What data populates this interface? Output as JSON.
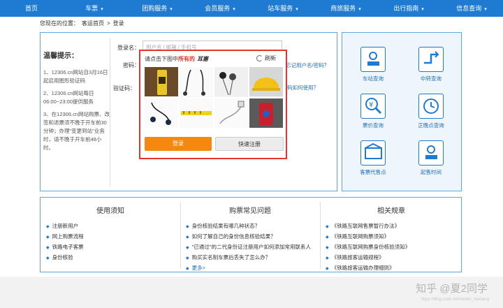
{
  "nav": [
    {
      "label": "首页",
      "caret": false
    },
    {
      "label": "车票",
      "caret": true
    },
    {
      "label": "团购服务",
      "caret": true
    },
    {
      "label": "会员服务",
      "caret": true
    },
    {
      "label": "站车服务",
      "caret": true
    },
    {
      "label": "商旅服务",
      "caret": true
    },
    {
      "label": "出行指南",
      "caret": true
    },
    {
      "label": "信息查询",
      "caret": true
    }
  ],
  "breadcrumb": {
    "prefix": "您现在的位置：",
    "home": "客运首页",
    "sep": ">",
    "current": "登录"
  },
  "tips": {
    "title": "温馨提示：",
    "items": [
      "1、12306.cn网站自3月16日起启用图形验证码",
      "2、12306.cn网站每日06:00~23:00提供服务",
      "3、在12306.cn网站购票、改签和退票须不晚于开车前30分钟；办理\"变更到站\"业务时，请不晚于开车前48小时。"
    ]
  },
  "form": {
    "username_label": "登录名：",
    "username_placeholder": "用户名 / 邮箱 / 手机号",
    "password_label": "密码：",
    "forgot": "忘记用户名/密码？",
    "captcha_label": "验证码：",
    "captcha_help": "验证码如何使用？",
    "captcha_prompt_a": "请点击下图中",
    "captcha_prompt_b": "所有的",
    "captcha_word": "耳塞",
    "refresh": "刷新",
    "login": "登录",
    "register": "快速注册"
  },
  "services": [
    "车站查询",
    "中转查询",
    "票价查询",
    "正晚点查询",
    "客票代售点",
    "起售时间"
  ],
  "bottom": {
    "cols": [
      {
        "title": "使用须知",
        "items": [
          "注册新用户",
          "网上购票流程",
          "铁路电子客票",
          "身份核验"
        ]
      },
      {
        "title": "购票常见问题",
        "items": [
          "身份核验结果有哪几种状态？",
          "如何了解自己的身份信息核验结果？",
          "\"已通过\"的二代身份证注册用户如何添加常用联系人",
          "购买实名制车票后丢失了怎么办？"
        ],
        "more": "更多>"
      },
      {
        "title": "相关规章",
        "items": [
          "《铁路互联网售票暂行办法》",
          "《铁路互联网购票须知》",
          "《铁路互联网购票身份核验须知》",
          "《铁路旅客运输规程》",
          "《铁路旅客运输办理细则》"
        ]
      }
    ]
  },
  "watermark": "知乎 @夏2同学",
  "watermark_url": "https://blog.csdn.net/weixin_xiaxiang"
}
